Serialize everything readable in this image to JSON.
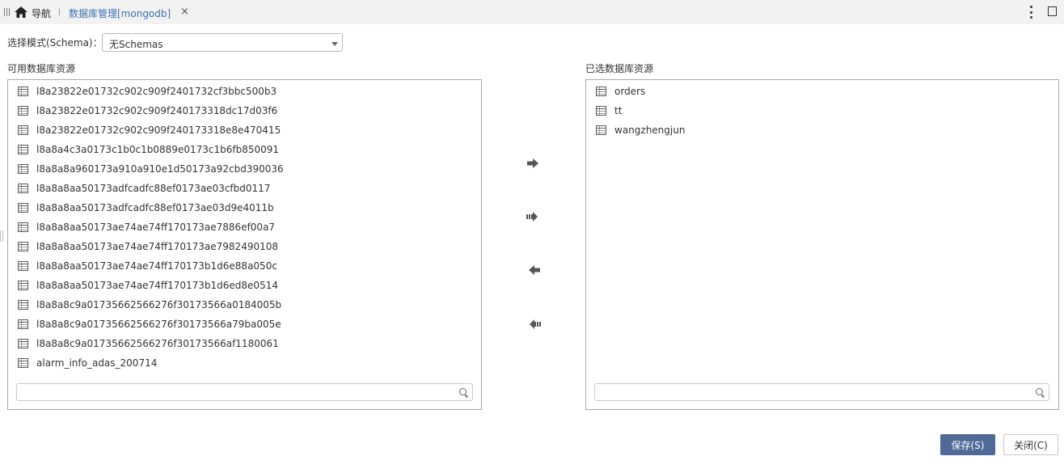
{
  "tabbar": {
    "nav_label": "导航",
    "tab_title": "数据库管理[mongodb]",
    "close_glyph": "×"
  },
  "schema": {
    "label": "选择模式(Schema)：",
    "selected": "无Schemas"
  },
  "available": {
    "title": "可用数据库资源",
    "items": [
      "l8a23822e01732c902c909f2401732cf3bbc500b3",
      "l8a23822e01732c902c909f240173318dc17d03f6",
      "l8a23822e01732c902c909f240173318e8e470415",
      "l8a8a4c3a0173c1b0c1b0889e0173c1b6fb850091",
      "l8a8a8a960173a910a910e1d50173a92cbd390036",
      "l8a8a8aa50173adfcadfc88ef0173ae03cfbd0117",
      "l8a8a8aa50173adfcadfc88ef0173ae03d9e4011b",
      "l8a8a8aa50173ae74ae74ff170173ae7886ef00a7",
      "l8a8a8aa50173ae74ae74ff170173ae7982490108",
      "l8a8a8aa50173ae74ae74ff170173b1d6e88a050c",
      "l8a8a8aa50173ae74ae74ff170173b1d6ed8e0514",
      "l8a8a8c9a01735662566276f30173566a0184005b",
      "l8a8a8c9a01735662566276f30173566a79ba005e",
      "l8a8a8c9a01735662566276f30173566af1180061",
      "alarm_info_adas_200714"
    ],
    "search_placeholder": ""
  },
  "selected": {
    "title": "已选数据库资源",
    "items": [
      "orders",
      "tt",
      "wangzhengjun"
    ],
    "search_placeholder": ""
  },
  "actions": {
    "save_label": "保存(S)",
    "close_label": "关闭(C)"
  }
}
